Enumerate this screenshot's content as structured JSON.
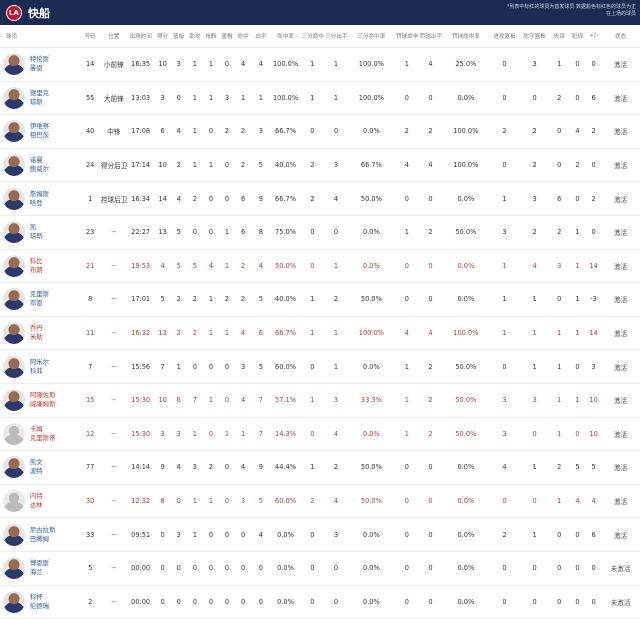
{
  "header": {
    "title": "快船",
    "logo_text": "LA",
    "note": "*列表中标红的球员为首发球员 数据颜色标红色的球员为正在上场的球员"
  },
  "columns": [
    "球员",
    "号码",
    "位置",
    "出场时间",
    "得分",
    "篮板",
    "助攻",
    "抢断",
    "盖帽",
    "命中",
    "出手",
    "命中率",
    "三分命中",
    "三分出手",
    "三分命中率",
    "罚球命中",
    "罚球出手",
    "罚球命中率",
    "进攻篮板",
    "防守篮板",
    "失误",
    "犯规",
    "+/-",
    "状态"
  ],
  "players": [
    {
      "first": "特伦斯",
      "last": "曼恩",
      "num": "14",
      "pos": "小前锋",
      "min": "16:35",
      "pts": "10",
      "reb": "3",
      "ast": "1",
      "stl": "1",
      "blk": "0",
      "fgm": "4",
      "fga": "4",
      "fgp": "100.0%",
      "tpm": "1",
      "tpa": "1",
      "tpp": "100.0%",
      "ftm": "1",
      "fta": "4",
      "ftp": "25.0%",
      "oreb": "0",
      "dreb": "3",
      "tov": "1",
      "pf": "0",
      "pm": "0",
      "status": "激活",
      "red": false,
      "ph": false
    },
    {
      "first": "德里克",
      "last": "琼斯",
      "num": "55",
      "pos": "大前锋",
      "min": "13:03",
      "pts": "3",
      "reb": "0",
      "ast": "1",
      "stl": "1",
      "blk": "3",
      "fgm": "1",
      "fga": "1",
      "fgp": "100.0%",
      "tpm": "1",
      "tpa": "1",
      "tpp": "100.0%",
      "ftm": "0",
      "fta": "0",
      "ftp": "0.0%",
      "oreb": "0",
      "dreb": "0",
      "tov": "2",
      "pf": "0",
      "pm": "6",
      "status": "激活",
      "red": false,
      "ph": false
    },
    {
      "first": "伊维察",
      "last": "祖巴茨",
      "num": "40",
      "pos": "中锋",
      "min": "17:08",
      "pts": "6",
      "reb": "4",
      "ast": "1",
      "stl": "0",
      "blk": "2",
      "fgm": "2",
      "fga": "3",
      "fgp": "66.7%",
      "tpm": "0",
      "tpa": "0",
      "tpp": "0.0%",
      "ftm": "2",
      "fta": "2",
      "ftp": "100.0%",
      "oreb": "2",
      "dreb": "2",
      "tov": "0",
      "pf": "4",
      "pm": "2",
      "status": "激活",
      "red": false,
      "ph": false
    },
    {
      "first": "诺曼",
      "last": "鲍威尔",
      "num": "24",
      "pos": "得分后卫",
      "min": "17:14",
      "pts": "10",
      "reb": "2",
      "ast": "1",
      "stl": "1",
      "blk": "0",
      "fgm": "2",
      "fga": "5",
      "fgp": "40.0%",
      "tpm": "2",
      "tpa": "3",
      "tpp": "66.7%",
      "ftm": "4",
      "fta": "4",
      "ftp": "100.0%",
      "oreb": "0",
      "dreb": "2",
      "tov": "0",
      "pf": "2",
      "pm": "0",
      "status": "激活",
      "red": false,
      "ph": false
    },
    {
      "first": "詹姆斯",
      "last": "哈登",
      "num": "1",
      "pos": "控球后卫",
      "min": "16:34",
      "pts": "14",
      "reb": "4",
      "ast": "2",
      "stl": "0",
      "blk": "0",
      "fgm": "6",
      "fga": "9",
      "fgp": "66.7%",
      "tpm": "2",
      "tpa": "4",
      "tpp": "50.0%",
      "ftm": "0",
      "fta": "0",
      "ftp": "0.0%",
      "oreb": "1",
      "dreb": "3",
      "tov": "6",
      "pf": "0",
      "pm": "2",
      "status": "激活",
      "red": false,
      "ph": false
    },
    {
      "first": "凯",
      "last": "琼斯",
      "num": "23",
      "pos": "--",
      "min": "22:27",
      "pts": "13",
      "reb": "5",
      "ast": "0",
      "stl": "0",
      "blk": "1",
      "fgm": "6",
      "fga": "8",
      "fgp": "75.0%",
      "tpm": "0",
      "tpa": "0",
      "tpp": "0.0%",
      "ftm": "1",
      "fta": "2",
      "ftp": "50.0%",
      "oreb": "3",
      "dreb": "2",
      "tov": "2",
      "pf": "1",
      "pm": "0",
      "status": "激活",
      "red": false,
      "ph": false
    },
    {
      "first": "科比",
      "last": "布朗",
      "num": "21",
      "pos": "--",
      "min": "19:53",
      "pts": "4",
      "reb": "5",
      "ast": "5",
      "stl": "4",
      "blk": "1",
      "fgm": "2",
      "fga": "4",
      "fgp": "50.0%",
      "tpm": "0",
      "tpa": "1",
      "tpp": "0.0%",
      "ftm": "0",
      "fta": "0",
      "ftp": "0.0%",
      "oreb": "1",
      "dreb": "4",
      "tov": "3",
      "pf": "1",
      "pm": "14",
      "status": "激活",
      "red": true,
      "ph": false
    },
    {
      "first": "克里斯",
      "last": "邓恩",
      "num": "8",
      "pos": "--",
      "min": "17:01",
      "pts": "5",
      "reb": "2",
      "ast": "2",
      "stl": "1",
      "blk": "2",
      "fgm": "2",
      "fga": "5",
      "fgp": "40.0%",
      "tpm": "1",
      "tpa": "2",
      "tpp": "50.0%",
      "ftm": "0",
      "fta": "0",
      "ftp": "0.0%",
      "oreb": "1",
      "dreb": "1",
      "tov": "0",
      "pf": "1",
      "pm": "-3",
      "status": "激活",
      "red": false,
      "ph": false
    },
    {
      "first": "乔丹",
      "last": "米勒",
      "num": "11",
      "pos": "--",
      "min": "16:32",
      "pts": "13",
      "reb": "2",
      "ast": "2",
      "stl": "1",
      "blk": "1",
      "fgm": "4",
      "fga": "6",
      "fgp": "66.7%",
      "tpm": "1",
      "tpa": "1",
      "tpp": "100.0%",
      "ftm": "4",
      "fta": "4",
      "ftp": "100.0%",
      "oreb": "1",
      "dreb": "1",
      "tov": "1",
      "pf": "1",
      "pm": "14",
      "status": "激活",
      "red": true,
      "ph": false
    },
    {
      "first": "阿米尔",
      "last": "科菲",
      "num": "7",
      "pos": "--",
      "min": "15:56",
      "pts": "7",
      "reb": "1",
      "ast": "0",
      "stl": "0",
      "blk": "0",
      "fgm": "3",
      "fga": "5",
      "fgp": "60.0%",
      "tpm": "0",
      "tpa": "1",
      "tpp": "0.0%",
      "ftm": "1",
      "fta": "2",
      "ftp": "50.0%",
      "oreb": "0",
      "dreb": "1",
      "tov": "1",
      "pf": "0",
      "pm": "3",
      "status": "激活",
      "red": false,
      "ph": false
    },
    {
      "first": "阿隆佐斯",
      "last": "威廉姆斯",
      "num": "15",
      "pos": "--",
      "min": "15:30",
      "pts": "10",
      "reb": "6",
      "ast": "7",
      "stl": "1",
      "blk": "0",
      "fgm": "4",
      "fga": "7",
      "fgp": "57.1%",
      "tpm": "1",
      "tpa": "3",
      "tpp": "33.3%",
      "ftm": "1",
      "fta": "2",
      "ftp": "50.0%",
      "oreb": "3",
      "dreb": "3",
      "tov": "1",
      "pf": "1",
      "pm": "10",
      "status": "激活",
      "red": true,
      "ph": false
    },
    {
      "first": "卡姆",
      "last": "克里斯蒂",
      "num": "12",
      "pos": "--",
      "min": "15:30",
      "pts": "3",
      "reb": "3",
      "ast": "1",
      "stl": "0",
      "blk": "1",
      "fgm": "1",
      "fga": "7",
      "fgp": "14.3%",
      "tpm": "0",
      "tpa": "4",
      "tpp": "0.0%",
      "ftm": "1",
      "fta": "2",
      "ftp": "50.0%",
      "oreb": "3",
      "dreb": "0",
      "tov": "1",
      "pf": "0",
      "pm": "10",
      "status": "激活",
      "red": true,
      "ph": true
    },
    {
      "first": "凯文",
      "last": "波特",
      "num": "77",
      "pos": "--",
      "min": "14:14",
      "pts": "9",
      "reb": "4",
      "ast": "3",
      "stl": "2",
      "blk": "0",
      "fgm": "4",
      "fga": "9",
      "fgp": "44.4%",
      "tpm": "1",
      "tpa": "2",
      "tpp": "50.0%",
      "ftm": "0",
      "fta": "0",
      "ftp": "0.0%",
      "oreb": "4",
      "dreb": "1",
      "tov": "2",
      "pf": "5",
      "pm": "5",
      "status": "激活",
      "red": false,
      "ph": false
    },
    {
      "first": "内特",
      "last": "达林",
      "num": "30",
      "pos": "--",
      "min": "12:32",
      "pts": "8",
      "reb": "0",
      "ast": "1",
      "stl": "1",
      "blk": "0",
      "fgm": "3",
      "fga": "5",
      "fgp": "60.0%",
      "tpm": "2",
      "tpa": "4",
      "tpp": "50.0%",
      "ftm": "0",
      "fta": "0",
      "ftp": "0.0%",
      "oreb": "0",
      "dreb": "0",
      "tov": "1",
      "pf": "4",
      "pm": "4",
      "status": "激活",
      "red": true,
      "ph": true
    },
    {
      "first": "尼古拉斯",
      "last": "巴腾姆",
      "num": "33",
      "pos": "--",
      "min": "09:51",
      "pts": "0",
      "reb": "3",
      "ast": "1",
      "stl": "0",
      "blk": "0",
      "fgm": "0",
      "fga": "4",
      "fgp": "0.0%",
      "tpm": "0",
      "tpa": "3",
      "tpp": "0.0%",
      "ftm": "0",
      "fta": "0",
      "ftp": "0.0%",
      "oreb": "2",
      "dreb": "1",
      "tov": "0",
      "pf": "0",
      "pm": "6",
      "status": "激活",
      "red": false,
      "ph": false
    },
    {
      "first": "博恩斯",
      "last": "海兰",
      "num": "5",
      "pos": "--",
      "min": "00:00",
      "pts": "0",
      "reb": "0",
      "ast": "0",
      "stl": "0",
      "blk": "0",
      "fgm": "0",
      "fga": "0",
      "fgp": "0.0%",
      "tpm": "0",
      "tpa": "0",
      "tpp": "0.0%",
      "ftm": "0",
      "fta": "0",
      "ftp": "0.0%",
      "oreb": "0",
      "dreb": "0",
      "tov": "0",
      "pf": "0",
      "pm": "0",
      "status": "未激活",
      "red": false,
      "ph": false
    },
    {
      "first": "科杯",
      "last": "伦德瑞",
      "num": "2",
      "pos": "--",
      "min": "00:00",
      "pts": "0",
      "reb": "0",
      "ast": "0",
      "stl": "0",
      "blk": "0",
      "fgm": "0",
      "fga": "0",
      "fgp": "0.0%",
      "tpm": "0",
      "tpa": "0",
      "tpp": "0.0%",
      "ftm": "0",
      "fta": "0",
      "ftp": "0.0%",
      "oreb": "0",
      "dreb": "0",
      "tov": "0",
      "pf": "0",
      "pm": "0",
      "status": "未激活",
      "red": false,
      "ph": false
    }
  ]
}
